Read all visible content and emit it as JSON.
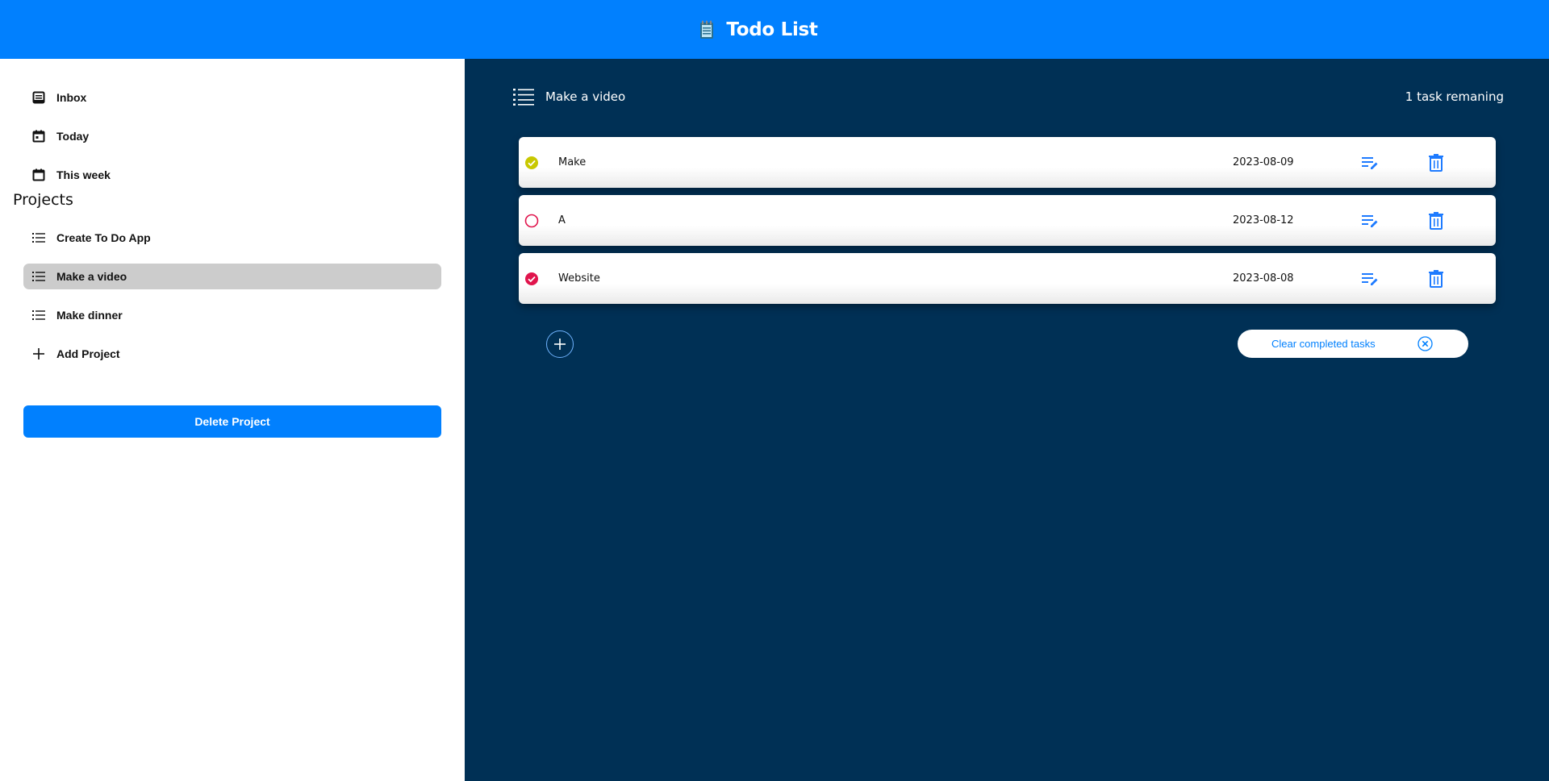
{
  "header": {
    "title": "Todo List",
    "logo_icon": "notepad-icon"
  },
  "colors": {
    "primary": "#0180fe",
    "main_bg": "#003055",
    "active_item": "#cccccc",
    "check_yellow": "#c8c800",
    "check_red": "#e0144c"
  },
  "sidebar": {
    "nav": [
      {
        "label": "Inbox",
        "icon": "inbox-icon"
      },
      {
        "label": "Today",
        "icon": "calendar-today-icon"
      },
      {
        "label": "This week",
        "icon": "calendar-week-icon"
      }
    ],
    "projects_heading": "Projects",
    "projects": [
      {
        "label": "Create To Do App",
        "icon": "list-icon",
        "active": false
      },
      {
        "label": "Make a video",
        "icon": "list-icon",
        "active": true
      },
      {
        "label": "Make dinner",
        "icon": "list-icon",
        "active": false
      }
    ],
    "add_project_label": "Add Project",
    "delete_project_label": "Delete Project"
  },
  "main": {
    "project_name": "Make a video",
    "remaining": "1 task remaning",
    "tasks": [
      {
        "name": "Make",
        "date": "2023-08-09",
        "status": "done-yellow"
      },
      {
        "name": "A",
        "date": "2023-08-12",
        "status": "open"
      },
      {
        "name": "Website",
        "date": "2023-08-08",
        "status": "done-red"
      }
    ],
    "clear_completed_label": "Clear completed tasks"
  }
}
